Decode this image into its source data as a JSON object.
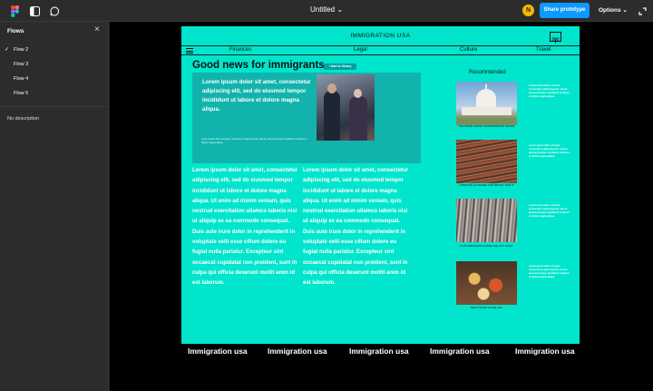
{
  "app": {
    "file_title": "Untitled",
    "avatar_initial": "N",
    "share_label": "Share prototype",
    "options_label": "Options"
  },
  "sidebar": {
    "title": "Flows",
    "flows": [
      {
        "label": "Flow 2",
        "selected": true
      },
      {
        "label": "Flow 3",
        "selected": false
      },
      {
        "label": "Flow 4",
        "selected": false
      },
      {
        "label": "Flow 5",
        "selected": false
      }
    ],
    "description": "No description"
  },
  "site": {
    "title": "IMMIGRATION USA",
    "nav": [
      "Finances",
      "Legal",
      "Culture",
      "Travel"
    ],
    "headline": "Good news for immigrants",
    "library_button": "+Add to library",
    "hero_text": "Lorem ipsum dolor sit amet, consectetur adipiscing elit, sed do eiusmod tempor  incididunt ut labore et dolore magna aliqua.",
    "hero_small": "Lorem ipsum dolor sit amet, consectetur adipiscing elit, sed do eiusmod tempor incididunt ut labore et dolore magna aliqua.",
    "body_col1": "Lorem ipsum dolor sit amet, consectetur adipiscing elit, sed do eiusmod tempor  incididunt ut labore et dolore magna aliqua. Ut enim ad minim veniam, quis nostrud exercitation ullamco laboris nisi ut aliquip ex ea commodo consequat. Duis aute irure dolor in reprehenderit in voluptate velit esse cillum dolore eu fugiat nulla pariatur. Excepteur sint occaecat cupidatat non proident, sunt in culpa qui officia deserunt mollit anim id est laborum.",
    "body_col2": "Lorem ipsum dolor sit amet, consectetur adipiscing elit, sed do eiusmod tempor  incididunt ut labore et dolore magna aliqua. Ut enim ad minim veniam, quis nostrud exercitation ullamco laboris nisi ut aliquip ex ea commodo consequat. Duis aute irure dolor in reprehenderit in voluptate velit esse cillum dolore eu fugiat nulla pariatur. Excepteur sint occaecat cupidatat non proident, sunt in culpa qui officia deserunt mollit anim id est laborum.",
    "recommended_title": "Recommended",
    "recommended": [
      {
        "caption": "THE WHITE HOUSE ON IMMIGRATION ISSUES",
        "text": "Lorem ipsum dolor sit amet, consectetur adipiscing elit, sed do eiusmod tempor incididunt ut labore et dolore magna aliqua."
      },
      {
        "caption": "LATEST BILLS PASSED THIS MONTH, FIND IT",
        "text": "Lorem ipsum dolor sit amet, consectetur adipiscing elit, sed do eiusmod tempor incididunt ut labore et dolore magna aliqua."
      },
      {
        "caption": "WHAT IMMIGRANTS MADE THE CITY TODAY",
        "text": "Lorem ipsum dolor sit amet, consectetur adipiscing elit, sed do eiusmod tempor incididunt ut labore et dolore magna aliqua."
      },
      {
        "caption": "BEST FOODS IN THE USA",
        "text": "Lorem ipsum dolor sit amet, consectetur adipiscing elit, sed do eiusmod tempor incididunt ut labore et dolore magna aliqua."
      }
    ],
    "footer_items": [
      "Immigration usa",
      "Immigration usa",
      "Immigration usa",
      "Immigration usa",
      "Immigration usa"
    ]
  },
  "colors": {
    "site_bg": "#00e5cc",
    "hero_bg": "#12b3ad",
    "share_blue": "#0d99ff"
  }
}
